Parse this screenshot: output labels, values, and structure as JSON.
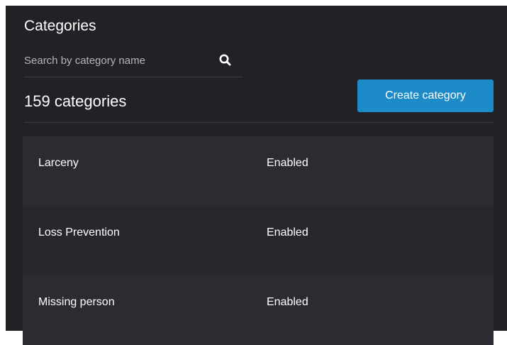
{
  "header": {
    "title": "Categories"
  },
  "search": {
    "placeholder": "Search by category name",
    "value": "",
    "icon": "search-icon"
  },
  "summary": {
    "count_label": "159 categories"
  },
  "actions": {
    "create_label": "Create category",
    "create_color": "#1d8bc8"
  },
  "categories": [
    {
      "name": "Larceny",
      "status": "Enabled"
    },
    {
      "name": "Loss Prevention",
      "status": "Enabled"
    },
    {
      "name": "Missing person",
      "status": "Enabled"
    }
  ],
  "theme": {
    "background": "#202226",
    "row_alt": "#26282d",
    "row": "#2a2c31"
  }
}
